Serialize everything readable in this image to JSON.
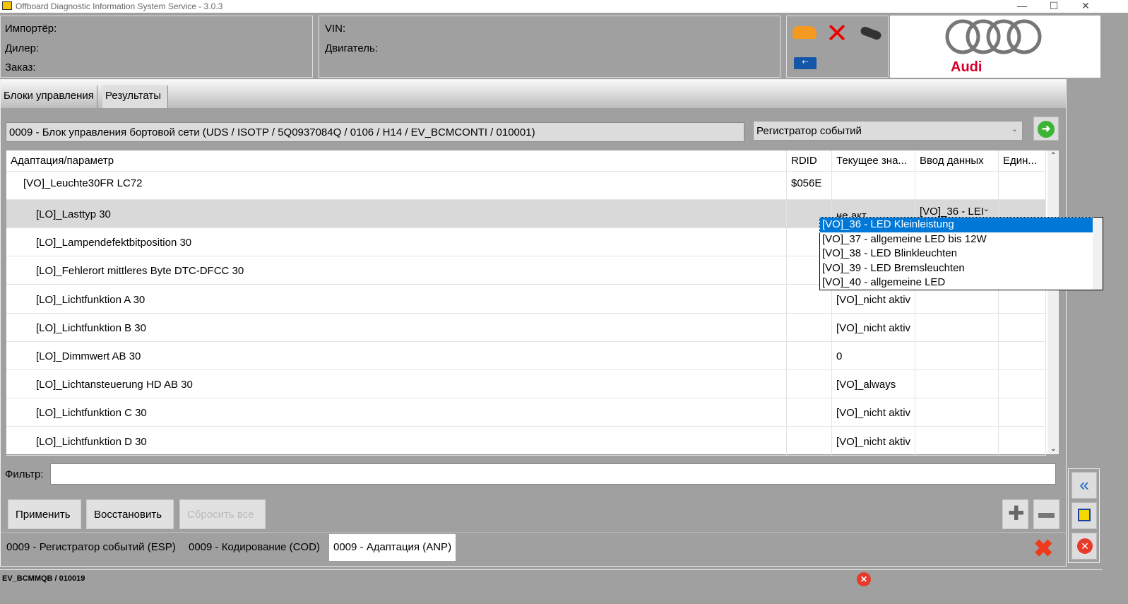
{
  "window": {
    "title": "Offboard Diagnostic Information System Service - 3.0.3",
    "min": "—",
    "max": "☐",
    "close": "✕"
  },
  "header": {
    "importer": "Импортёр:",
    "dealer": "Дилер:",
    "order": "Заказ:",
    "vin": "VIN:",
    "engine": "Двигатель:",
    "brand": "Audi"
  },
  "tabs": [
    "Блоки управления",
    "Результаты"
  ],
  "ecu": "0009 - Блок управления бортовой сети  (UDS / ISOTP / 5Q0937084Q  / 0106 / H14 / EV_BCMCONTI / 010001)",
  "function_select": "Регистратор событий",
  "table": {
    "headers": [
      "Адаптация/параметр",
      "RDID",
      "Текущее зна...",
      "Ввод данных",
      "Един..."
    ],
    "rows": [
      {
        "name": "[VO]_Leuchte30FR LC72",
        "rdid": "$056E",
        "current": "",
        "input": ""
      },
      {
        "name": "[LO]_Lasttyp 30",
        "rdid": "",
        "current": "не акт.",
        "input": "[VO]_36 - LEI"
      },
      {
        "name": "[LO]_Lampendefektbitposition 30",
        "rdid": "",
        "current": "",
        "input": ""
      },
      {
        "name": "[LO]_Fehlerort mittleres Byte DTC-DFCC 30",
        "rdid": "",
        "current": "",
        "input": ""
      },
      {
        "name": "[LO]_Lichtfunktion A 30",
        "rdid": "",
        "current": "[VO]_nicht aktiv",
        "input": ""
      },
      {
        "name": "[LO]_Lichtfunktion B 30",
        "rdid": "",
        "current": "[VO]_nicht aktiv",
        "input": ""
      },
      {
        "name": "[LO]_Dimmwert AB 30",
        "rdid": "",
        "current": "0",
        "input": ""
      },
      {
        "name": "[LO]_Lichtansteuerung HD AB 30",
        "rdid": "",
        "current": "[VO]_always",
        "input": ""
      },
      {
        "name": "[LO]_Lichtfunktion C 30",
        "rdid": "",
        "current": "[VO]_nicht aktiv",
        "input": ""
      },
      {
        "name": "[LO]_Lichtfunktion D 30",
        "rdid": "",
        "current": "[VO]_nicht aktiv",
        "input": ""
      }
    ]
  },
  "dropdown": [
    "[VO]_36 - LED Kleinleistung",
    "[VO]_37 - allgemeine LED bis 12W",
    "[VO]_38 - LED Blinkleuchten",
    "[VO]_39 - LED Bremsleuchten",
    "[VO]_40 - allgemeine LED"
  ],
  "filter": {
    "label": "Фильтр:",
    "value": ""
  },
  "buttons": {
    "apply": "Применить",
    "restore": "Восстановить",
    "reset_all": "Сбросить все"
  },
  "bottom_tabs": [
    "0009 - Регистратор событий (ESP)",
    "0009 - Кодирование (COD)",
    "0009 - Адаптация (ANP)"
  ],
  "status": "EV_BCMMQB / 010019",
  "colors": {
    "bg": "#a0a0a0",
    "selected": "#0078d7",
    "audi_red": "#d4002a"
  }
}
